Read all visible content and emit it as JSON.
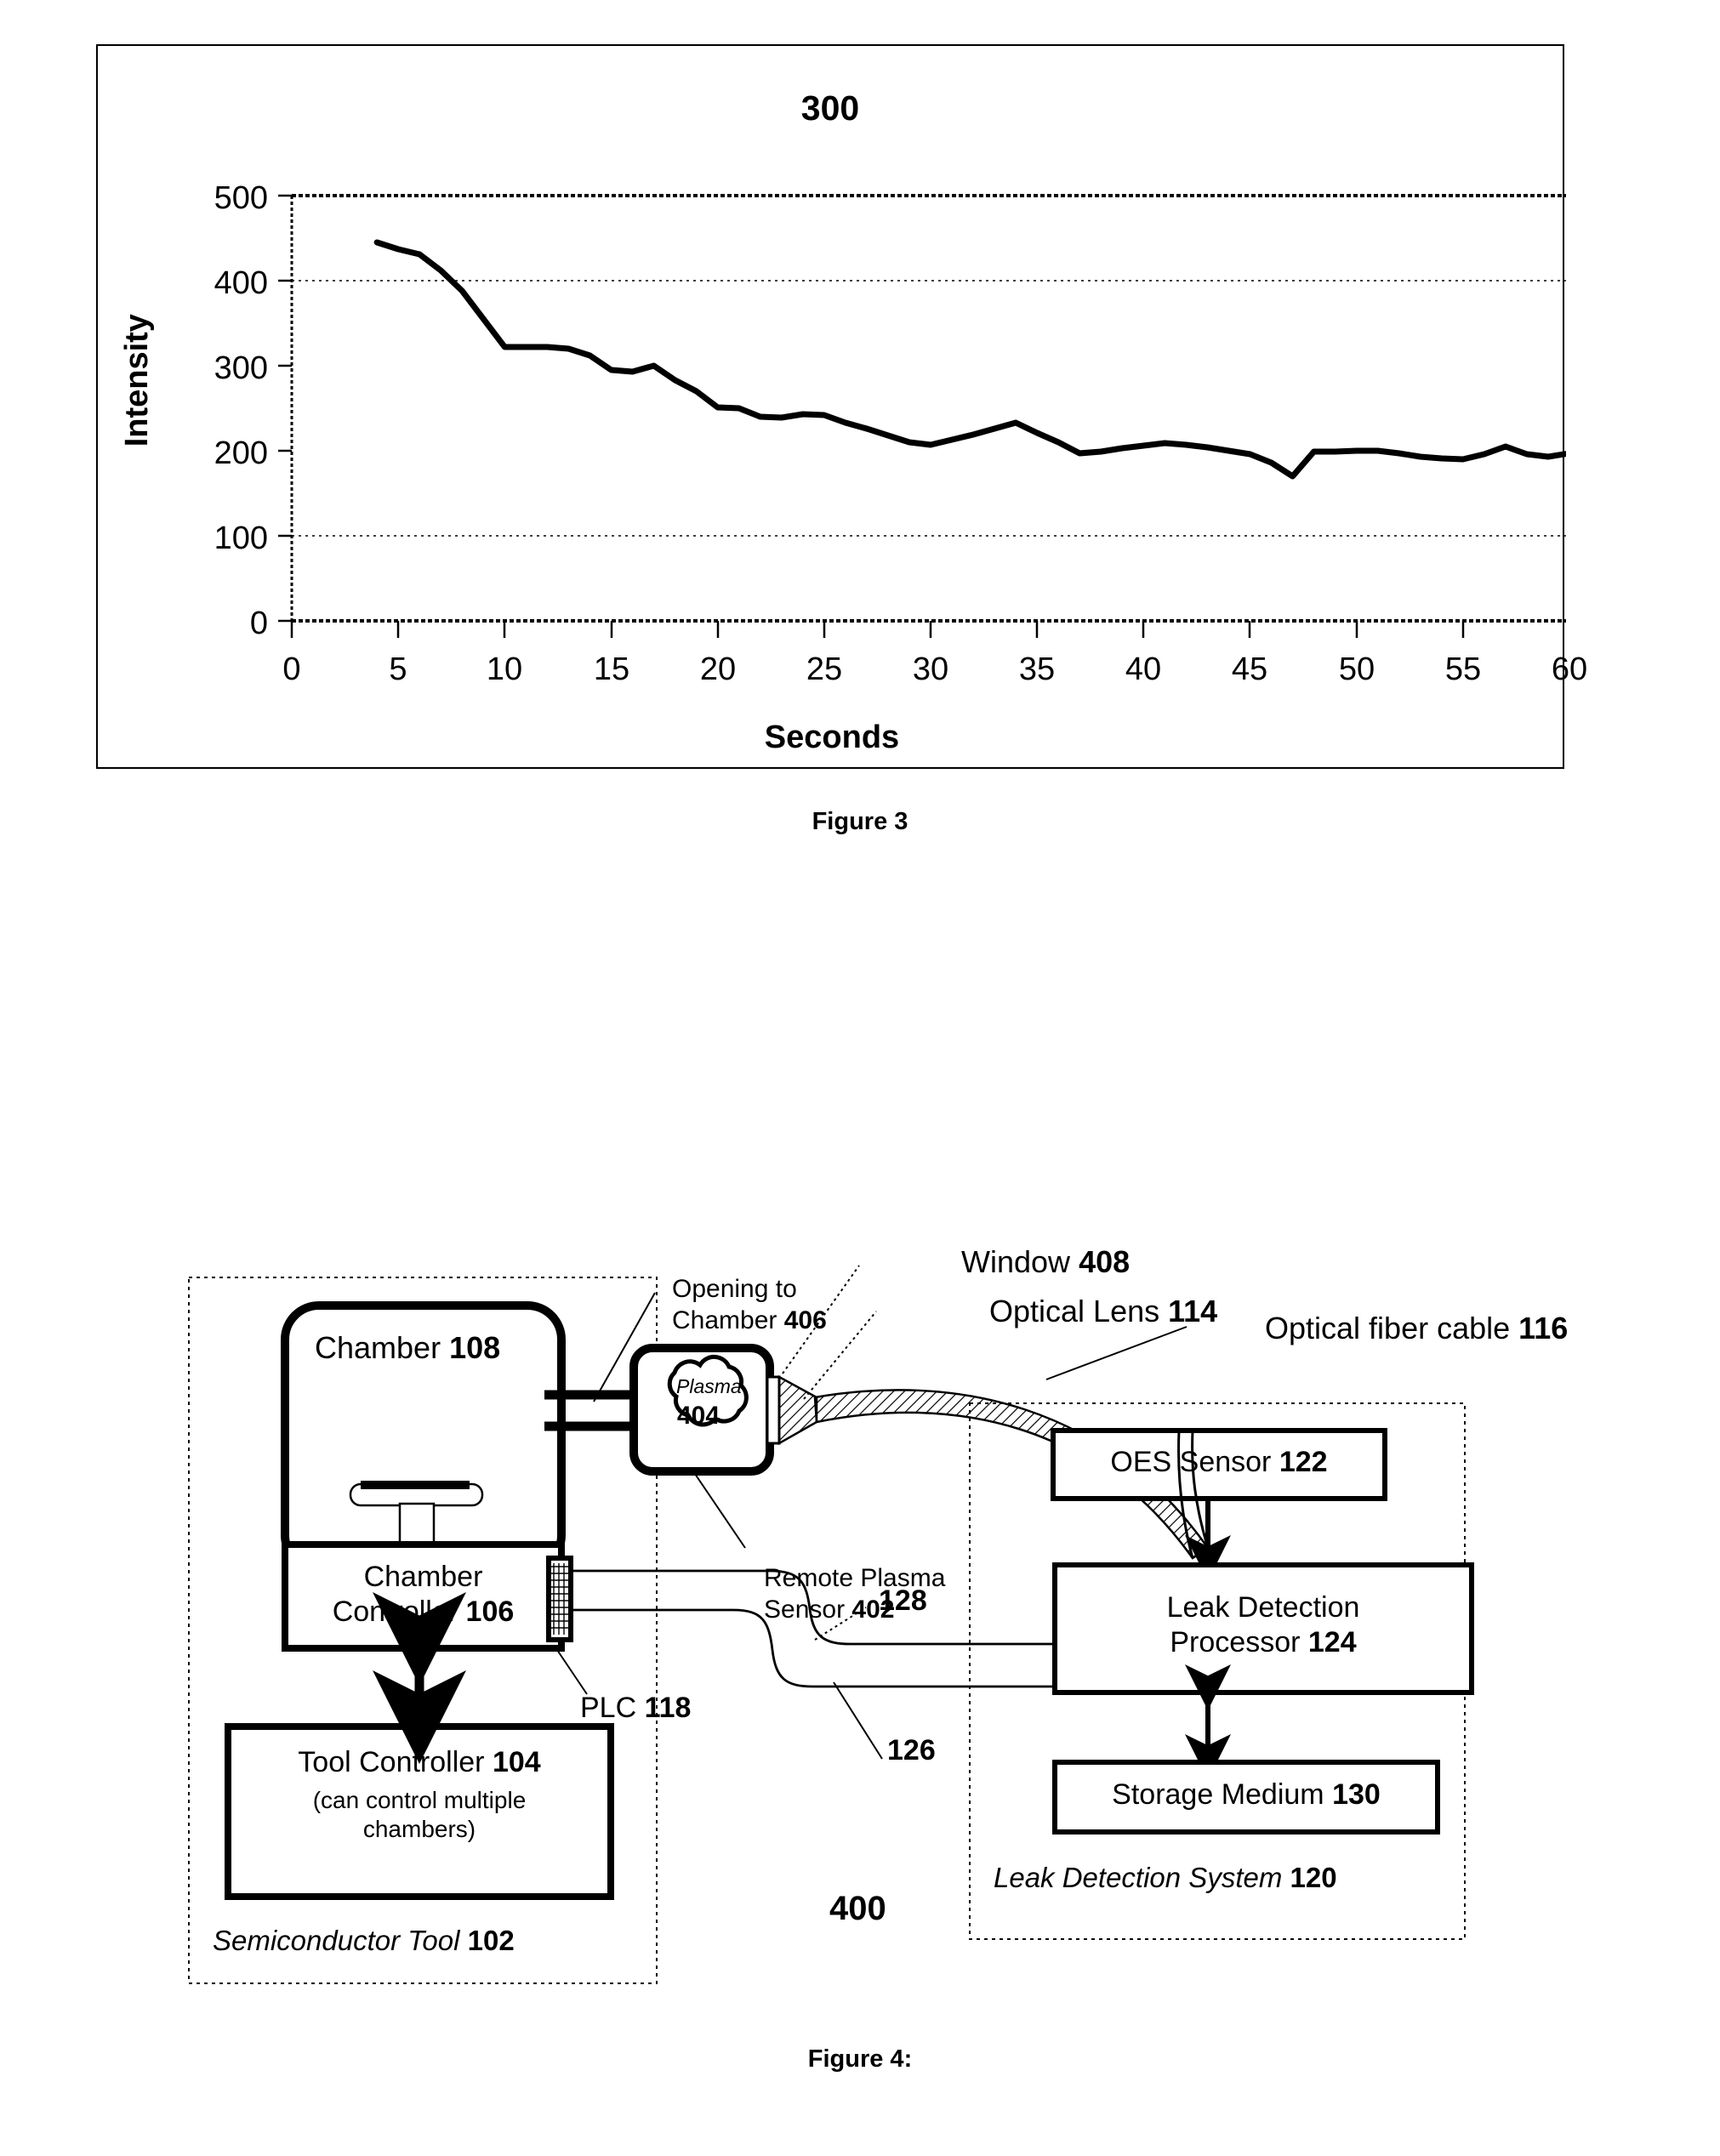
{
  "figure3": {
    "caption": "Figure 3",
    "title": "300"
  },
  "chart_data": {
    "type": "line",
    "title": "300",
    "xlabel": "Seconds",
    "ylabel": "Intensity",
    "xlim": [
      0,
      60
    ],
    "ylim": [
      0,
      500
    ],
    "xticks": [
      "0",
      "5",
      "10",
      "15",
      "20",
      "25",
      "30",
      "35",
      "40",
      "45",
      "50",
      "55",
      "60"
    ],
    "yticks": [
      "0",
      "100",
      "200",
      "300",
      "400",
      "500"
    ],
    "grid": "horizontal-dotted",
    "legend": "none",
    "series": [
      {
        "name": "Intensity",
        "x": [
          4,
          5,
          6,
          7,
          8,
          9,
          10,
          11,
          12,
          13,
          14,
          15,
          16,
          17,
          18,
          19,
          20,
          21,
          22,
          23,
          24,
          25,
          26,
          27,
          28,
          29,
          30,
          31,
          32,
          33,
          34,
          35,
          36,
          37,
          38,
          39,
          40,
          41,
          42,
          43,
          44,
          45,
          46,
          47,
          48,
          49,
          50,
          51,
          52,
          53,
          54,
          55,
          56,
          57,
          58,
          59,
          60
        ],
        "values": [
          445,
          437,
          431,
          412,
          388,
          355,
          322,
          322,
          322,
          320,
          312,
          295,
          293,
          300,
          283,
          270,
          251,
          250,
          240,
          239,
          243,
          242,
          233,
          226,
          218,
          210,
          207,
          213,
          219,
          226,
          233,
          221,
          210,
          197,
          199,
          203,
          206,
          209,
          207,
          204,
          200,
          196,
          186,
          170,
          199,
          199,
          200,
          200,
          197,
          193,
          191,
          190,
          196,
          205,
          196,
          193,
          197
        ]
      }
    ]
  },
  "figure4": {
    "caption": "Figure 4:",
    "ref_number": "400",
    "semiconductor_tool_label": "Semiconductor Tool",
    "semiconductor_tool_ref": "102",
    "chamber_label": "Chamber",
    "chamber_ref": "108",
    "chamber_controller_line1": "Chamber",
    "chamber_controller_line2": "Controller",
    "chamber_controller_ref": "106",
    "tool_controller_label": "Tool Controller",
    "tool_controller_ref": "104",
    "tool_controller_note_line1": "(can control multiple",
    "tool_controller_note_line2": "chambers)",
    "plasma_label": "Plasma",
    "plasma_ref": "404",
    "opening_line1": "Opening to",
    "opening_line2": "Chamber",
    "opening_ref": "406",
    "remote_plasma_line1": "Remote Plasma",
    "remote_plasma_line2": "Sensor",
    "remote_plasma_ref": "402",
    "window_label": "Window",
    "window_ref": "408",
    "optical_lens_label": "Optical Lens",
    "optical_lens_ref": "114",
    "optical_fiber_label": "Optical fiber cable",
    "optical_fiber_ref": "116",
    "plc_label": "PLC",
    "plc_ref": "118",
    "link_128": "128",
    "link_126": "126",
    "oes_sensor_label": "OES Sensor",
    "oes_sensor_ref": "122",
    "leak_proc_line1": "Leak Detection",
    "leak_proc_line2": "Processor",
    "leak_proc_ref": "124",
    "storage_label": "Storage Medium",
    "storage_ref": "130",
    "leak_system_label": "Leak Detection System",
    "leak_system_ref": "120"
  }
}
